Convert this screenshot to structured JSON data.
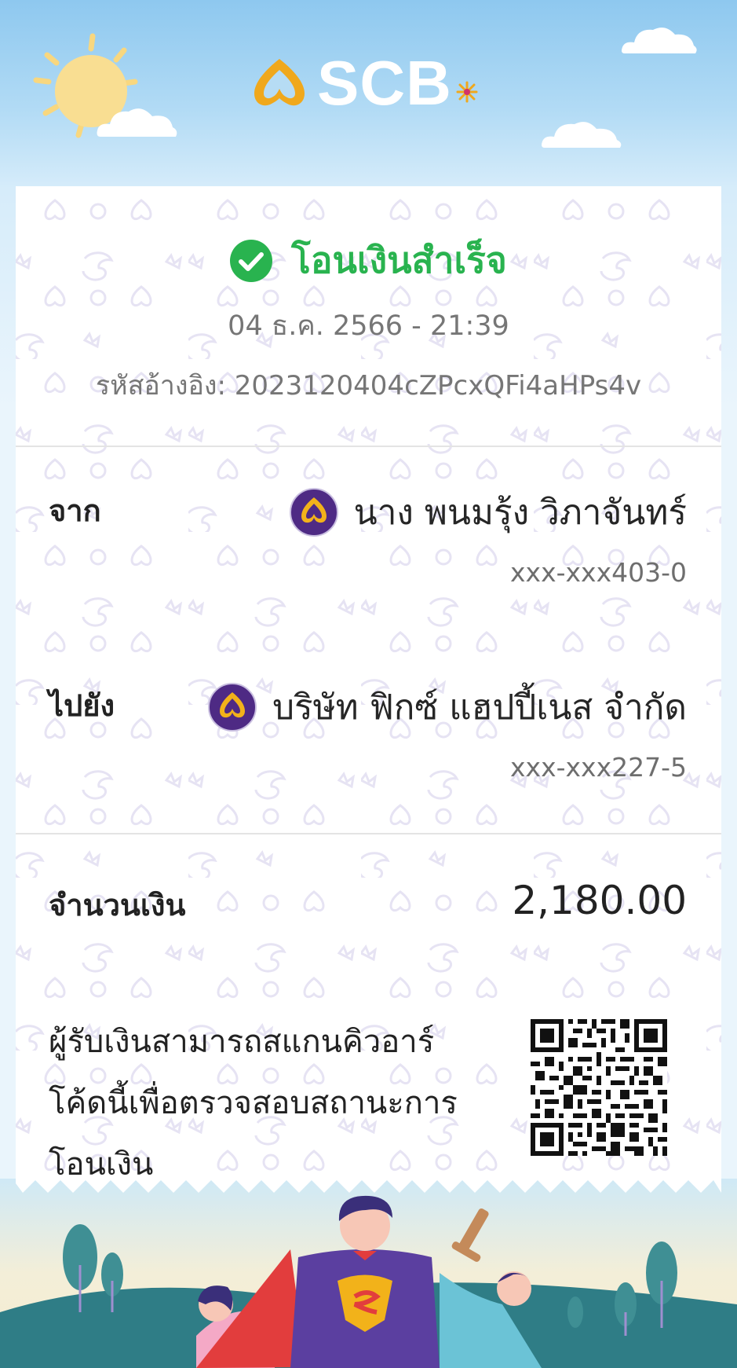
{
  "brand": {
    "name": "SCB"
  },
  "receipt": {
    "status": "โอนเงินสำเร็จ",
    "datetime": "04 ธ.ค. 2566 - 21:39",
    "reference_label": "รหัสอ้างอิง:",
    "reference_value": "2023120404cZPcxQFi4aHPs4v",
    "from": {
      "label": "จาก",
      "name": "นาง พนมรุ้ง วิภาจันทร์",
      "account": "xxx-xxx403-0"
    },
    "to": {
      "label": "ไปยัง",
      "name": "บริษัท ฟิกซ์ แฮปปี้เนส จำกัด",
      "account": "xxx-xxx227-5"
    },
    "amount_label": "จำนวนเงิน",
    "amount": "2,180.00",
    "qr_note": "ผู้รับเงินสามารถสแกนคิวอาร์โค้ดนี้เพื่อตรวจสอบสถานะการโอนเงิน"
  },
  "colors": {
    "success": "#29b34f",
    "bank_purple": "#4e2a84",
    "bank_gold": "#f2b21a"
  },
  "icons": {
    "status": "check-circle-icon",
    "bank": "scb-logo-icon"
  }
}
